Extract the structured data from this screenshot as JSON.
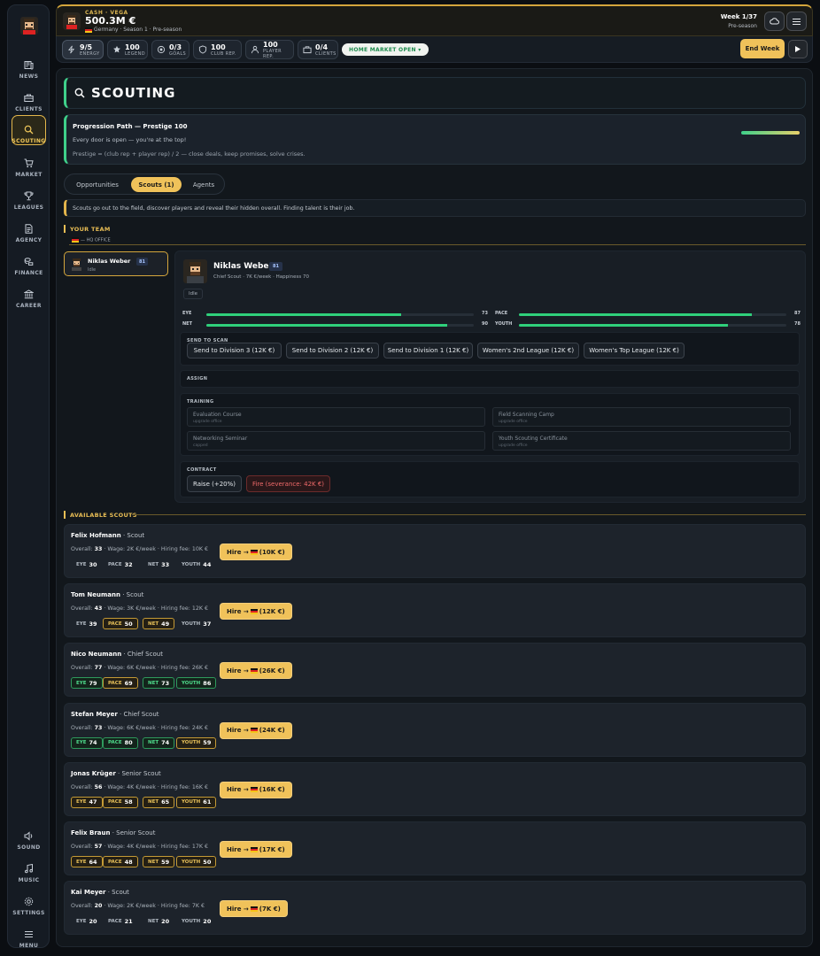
{
  "sidebar": {
    "items": [
      {
        "label": "NEWS",
        "icon": "newspaper-icon"
      },
      {
        "label": "CLIENTS",
        "icon": "briefcase-icon"
      },
      {
        "label": "SCOUTING",
        "icon": "search-icon"
      },
      {
        "label": "MARKET",
        "icon": "cart-icon"
      },
      {
        "label": "LEAGUES",
        "icon": "trophy-icon"
      },
      {
        "label": "AGENCY",
        "icon": "document-icon"
      },
      {
        "label": "FINANCE",
        "icon": "coins-icon"
      },
      {
        "label": "CAREER",
        "icon": "bank-icon"
      }
    ],
    "bottom_items": [
      {
        "label": "SOUND",
        "icon": "speaker-icon"
      },
      {
        "label": "MUSIC",
        "icon": "music-icon"
      },
      {
        "label": "SETTINGS",
        "icon": "gear-icon"
      },
      {
        "label": "MENU",
        "icon": "hamburger-icon"
      }
    ],
    "active": "SCOUTING"
  },
  "header": {
    "cash_label": "CASH · VEGA",
    "cash_value": "500.3M €",
    "subtitle": "Germany · Season 1 · Pre-season",
    "week": "Week 1/37",
    "phase": "Pre-season"
  },
  "stats": [
    {
      "value": "9/5",
      "label": "ENERGY"
    },
    {
      "value": "100",
      "label": "LEGEND"
    },
    {
      "value": "0/3",
      "label": "GOALS"
    },
    {
      "value": "100",
      "label": "CLUB REP."
    },
    {
      "value": "100",
      "label": "PLAYER REP."
    },
    {
      "value": "0/4",
      "label": "CLIENTS"
    }
  ],
  "market_status": "HOME MARKET OPEN ▾",
  "end_week_label": "End Week",
  "page_title": "SCOUTING",
  "progression": {
    "title": "Progression Path — Prestige 100",
    "desc": "Every door is open — you're at the top!",
    "formula": "Prestige = (club rep + player rep) / 2 — close deals, keep promises, solve crises.",
    "fraction": 1.0
  },
  "tabs": [
    {
      "label": "Opportunities"
    },
    {
      "label": "Scouts (1)"
    },
    {
      "label": "Agents"
    }
  ],
  "hint": "Scouts go out to the field, discover players and reveal their hidden overall. Finding talent is their job.",
  "your_team": {
    "title": "YOUR TEAM",
    "office": "— HQ OFFICE",
    "card": {
      "name": "Niklas Weber",
      "rating": "81",
      "status": "Idle"
    }
  },
  "detail": {
    "name": "Niklas Weber",
    "rating": "81",
    "sub": "Chief Scout · 7K €/week · Happiness 70",
    "status": "Idle",
    "bars": [
      {
        "label": "EYE",
        "value": 73
      },
      {
        "label": "PACE",
        "value": 87
      },
      {
        "label": "NET",
        "value": 90
      },
      {
        "label": "YOUTH",
        "value": 78
      }
    ],
    "scan_title": "SEND TO SCAN",
    "scan_buttons": [
      "Send to Division 3 (12K €)",
      "Send to Division 2 (12K €)",
      "Send to Division 1 (12K €)",
      "Women's 2nd League (12K €)",
      "Women's Top League (12K €)"
    ],
    "assign_title": "ASSIGN",
    "training_title": "TRAINING",
    "training": [
      {
        "name": "Evaluation Course",
        "status": "upgrade office"
      },
      {
        "name": "Field Scanning Camp",
        "status": "upgrade office"
      },
      {
        "name": "Networking Seminar",
        "status": "capped"
      },
      {
        "name": "Youth Scouting Certificate",
        "status": "upgrade office"
      }
    ],
    "contract_title": "CONTRACT",
    "raise_label": "Raise (+20%)",
    "fire_label": "Fire (severance: 42K €)"
  },
  "available_title": "AVAILABLE SCOUTS",
  "scouts": [
    {
      "name": "Felix Hofmann",
      "role": "· Scout",
      "overall": "33",
      "info": "· Wage: 2K €/week · Hiring fee: 10K €",
      "hire": "Hire →",
      "fee": "(10K €)",
      "stats": [
        {
          "l": "EYE",
          "v": "30",
          "c": ""
        },
        {
          "l": "PACE",
          "v": "32",
          "c": ""
        },
        {
          "l": "NET",
          "v": "33",
          "c": ""
        },
        {
          "l": "YOUTH",
          "v": "44",
          "c": ""
        }
      ]
    },
    {
      "name": "Tom Neumann",
      "role": "· Scout",
      "overall": "43",
      "info": "· Wage: 3K €/week · Hiring fee: 12K €",
      "hire": "Hire →",
      "fee": "(12K €)",
      "stats": [
        {
          "l": "EYE",
          "v": "39",
          "c": ""
        },
        {
          "l": "PACE",
          "v": "50",
          "c": "y"
        },
        {
          "l": "NET",
          "v": "49",
          "c": "y"
        },
        {
          "l": "YOUTH",
          "v": "37",
          "c": ""
        }
      ]
    },
    {
      "name": "Nico Neumann",
      "role": "· Chief Scout",
      "overall": "77",
      "info": "· Wage: 6K €/week · Hiring fee: 26K €",
      "hire": "Hire →",
      "fee": "(26K €)",
      "stats": [
        {
          "l": "EYE",
          "v": "79",
          "c": "g"
        },
        {
          "l": "PACE",
          "v": "69",
          "c": "y"
        },
        {
          "l": "NET",
          "v": "73",
          "c": "g"
        },
        {
          "l": "YOUTH",
          "v": "86",
          "c": "g"
        }
      ]
    },
    {
      "name": "Stefan Meyer",
      "role": "· Chief Scout",
      "overall": "73",
      "info": "· Wage: 6K €/week · Hiring fee: 24K €",
      "hire": "Hire →",
      "fee": "(24K €)",
      "stats": [
        {
          "l": "EYE",
          "v": "74",
          "c": "g"
        },
        {
          "l": "PACE",
          "v": "80",
          "c": "g"
        },
        {
          "l": "NET",
          "v": "74",
          "c": "g"
        },
        {
          "l": "YOUTH",
          "v": "59",
          "c": "y"
        }
      ]
    },
    {
      "name": "Jonas Krüger",
      "role": "· Senior Scout",
      "overall": "56",
      "info": "· Wage: 4K €/week · Hiring fee: 16K €",
      "hire": "Hire →",
      "fee": "(16K €)",
      "stats": [
        {
          "l": "EYE",
          "v": "47",
          "c": "y"
        },
        {
          "l": "PACE",
          "v": "58",
          "c": "y"
        },
        {
          "l": "NET",
          "v": "65",
          "c": "y"
        },
        {
          "l": "YOUTH",
          "v": "61",
          "c": "y"
        }
      ]
    },
    {
      "name": "Felix Braun",
      "role": "· Senior Scout",
      "overall": "57",
      "info": "· Wage: 4K €/week · Hiring fee: 17K €",
      "hire": "Hire →",
      "fee": "(17K €)",
      "stats": [
        {
          "l": "EYE",
          "v": "64",
          "c": "y"
        },
        {
          "l": "PACE",
          "v": "48",
          "c": "y"
        },
        {
          "l": "NET",
          "v": "59",
          "c": "y"
        },
        {
          "l": "YOUTH",
          "v": "50",
          "c": "y"
        }
      ]
    },
    {
      "name": "Kai Meyer",
      "role": "· Scout",
      "overall": "20",
      "info": "· Wage: 2K €/week · Hiring fee: 7K €",
      "hire": "Hire →",
      "fee": "(7K €)",
      "stats": [
        {
          "l": "EYE",
          "v": "20",
          "c": ""
        },
        {
          "l": "PACE",
          "v": "21",
          "c": ""
        },
        {
          "l": "NET",
          "v": "20",
          "c": ""
        },
        {
          "l": "YOUTH",
          "v": "20",
          "c": ""
        }
      ]
    }
  ],
  "colors": {
    "accent": "#f0c25a",
    "good": "#2fd07b",
    "danger": "#f06a6a",
    "background": "#0b0e12"
  }
}
